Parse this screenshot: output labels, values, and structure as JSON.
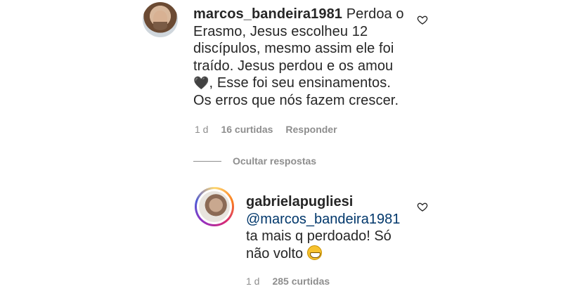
{
  "comment": {
    "username": "marcos_bandeira1981",
    "text_part1": " Perdoa o Erasmo, Jesus escolheu 12 discípulos, mesmo assim ele foi traído. Jesus perdou e os amou ",
    "heart_emoji": "🖤",
    "text_part2": ", Esse foi seu ensinamentos. Os erros que nós fazem crescer.",
    "time": "1 d",
    "likes": "16 curtidas",
    "reply_label": "Responder"
  },
  "thread": {
    "hide_replies_label": "Ocultar respostas"
  },
  "reply": {
    "username": "gabrielapugliesi",
    "mention": "@marcos_bandeira1981",
    "text": "ta mais q perdoado! Só não volto",
    "time": "1 d",
    "likes": "285 curtidas"
  },
  "icons": {
    "like": "heart-outline-icon",
    "emoji": "grinning-face-icon"
  }
}
